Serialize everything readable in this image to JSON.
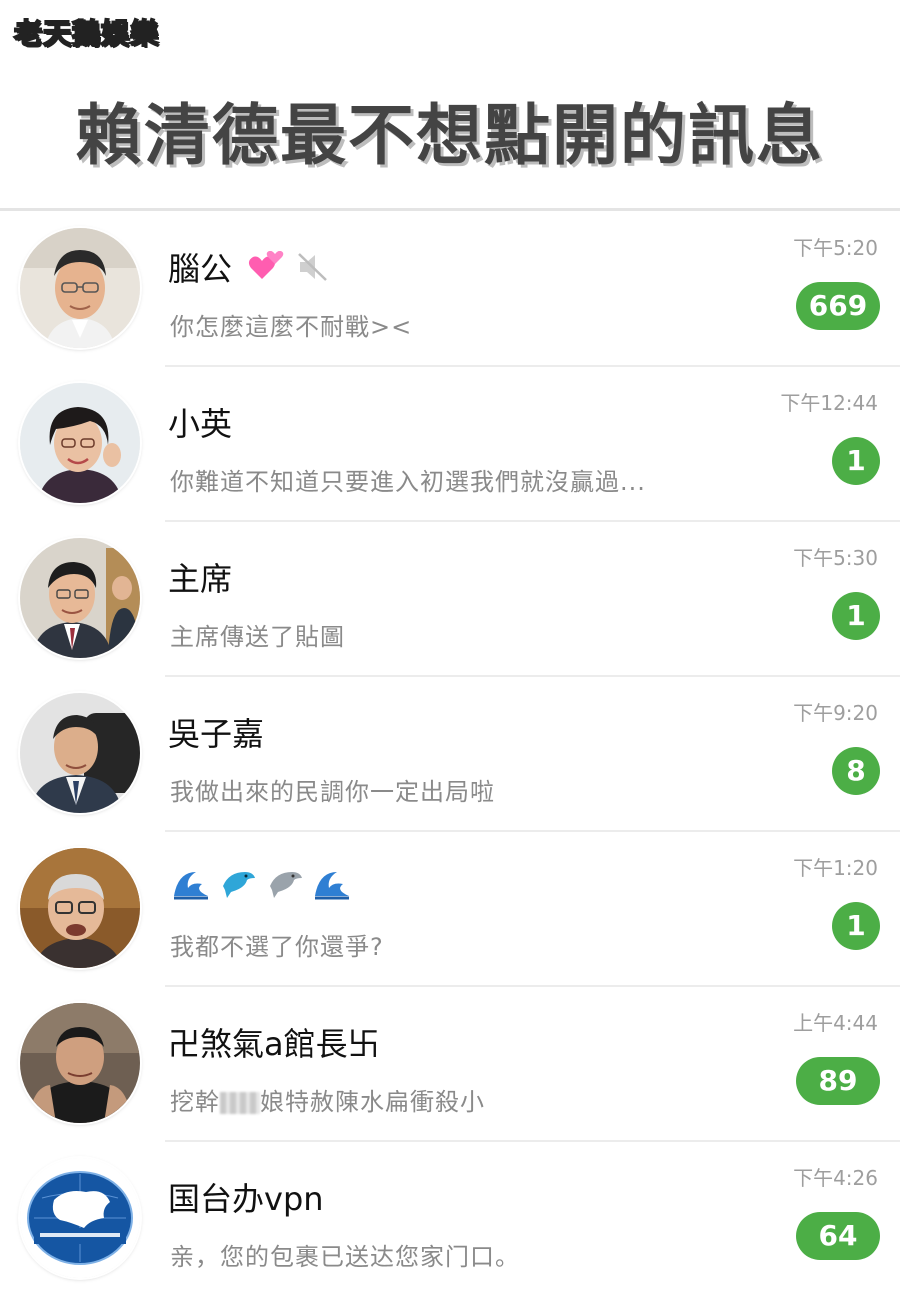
{
  "brand": {
    "logo_text_a": "老天",
    "logo_text_b": "鵝",
    "logo_text_c": "娛樂"
  },
  "headline": "賴清德最不想點開的訊息",
  "chats": [
    {
      "name": "腦公",
      "name_icons": [
        "two-hearts-icon",
        "muted-speaker-icon"
      ],
      "preview": "你怎麼這麼不耐戰><",
      "time": "下午5:20",
      "unread": "669"
    },
    {
      "name": "小英",
      "preview": "你難道不知道只要進入初選我們就沒贏過...",
      "time": "下午12:44",
      "unread": "1"
    },
    {
      "name": "主席",
      "preview": "主席傳送了貼圖",
      "time": "下午5:30",
      "unread": "1"
    },
    {
      "name": "吳子嘉",
      "preview": "我做出來的民調你一定出局啦",
      "time": "下午9:20",
      "unread": "8"
    },
    {
      "name_emojis": [
        "wave-icon",
        "dolphin-icon",
        "dolphin-gray-icon",
        "wave-icon"
      ],
      "preview": "我都不選了你還爭?",
      "time": "下午1:20",
      "unread": "1"
    },
    {
      "name": "卍煞氣a館長卐",
      "preview_a": "挖幹",
      "preview_b": "娘特赦陳水扁衝殺小",
      "time": "上午4:44",
      "unread": "89"
    },
    {
      "name": "国台办vpn",
      "preview": "亲，您的包裹已送达您家门口。",
      "time": "下午4:26",
      "unread": "64"
    }
  ],
  "colors": {
    "badge_green": "#4cae46",
    "time_gray": "#9e9e9e",
    "preview_gray": "#8a8a8a"
  }
}
